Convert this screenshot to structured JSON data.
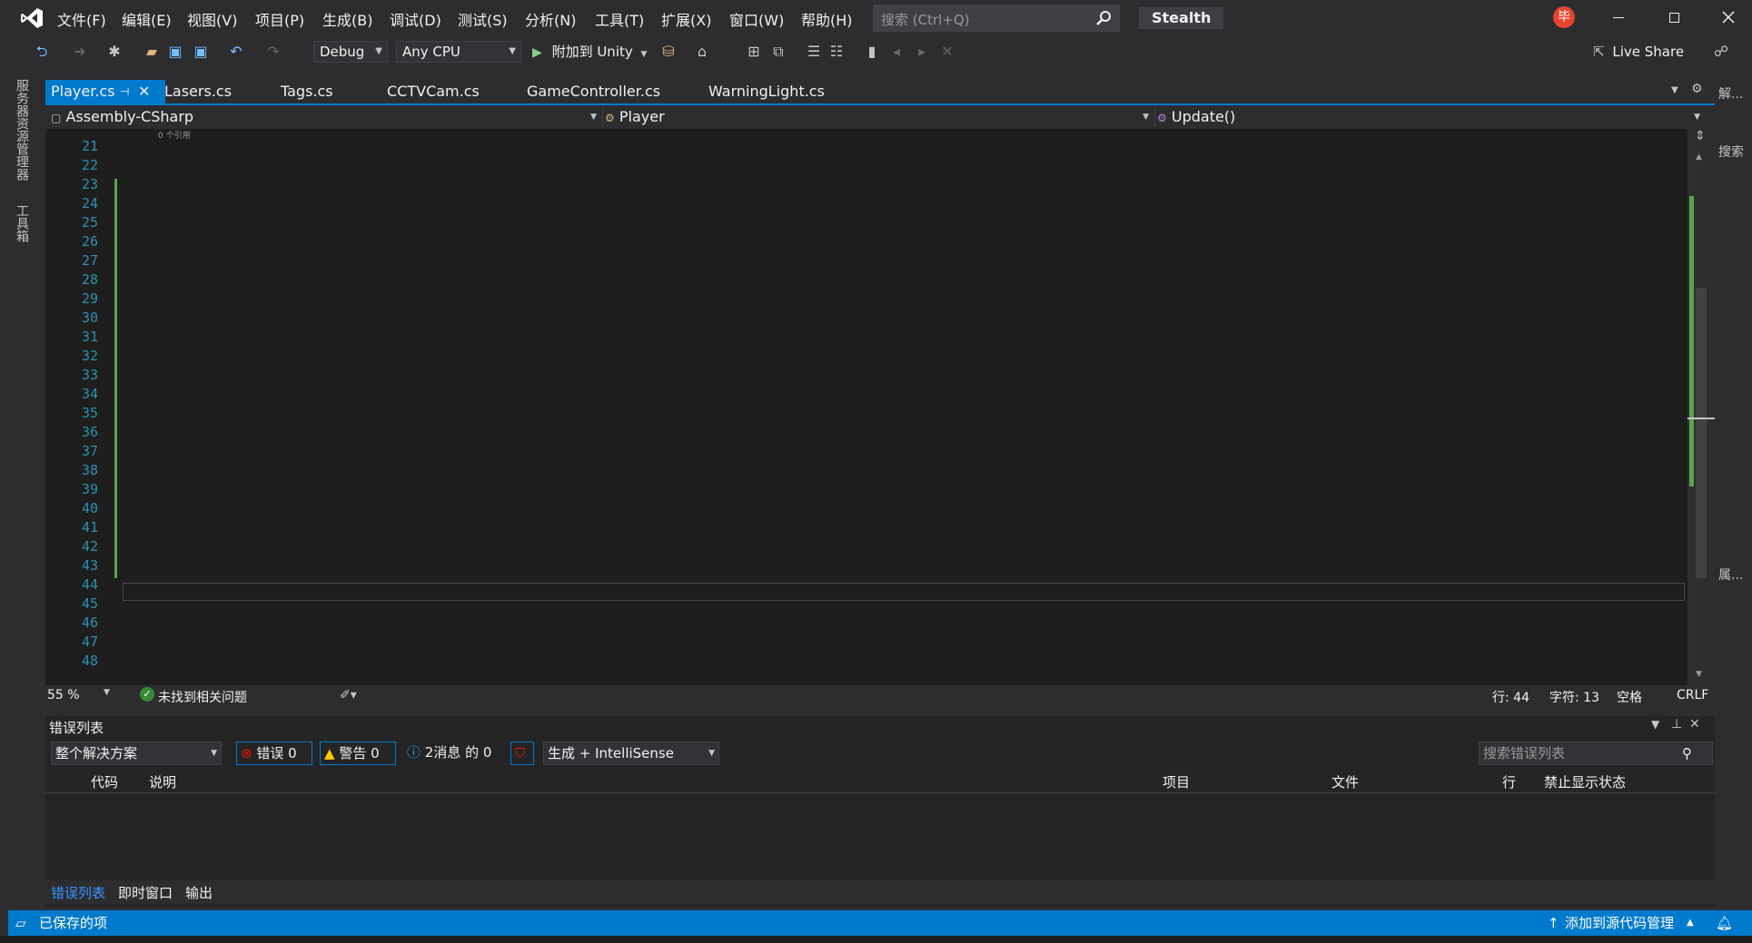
{
  "menu": [
    "文件(F)",
    "编辑(E)",
    "视图(V)",
    "项目(P)",
    "生成(B)",
    "调试(D)",
    "测试(S)",
    "分析(N)",
    "工具(T)",
    "扩展(X)",
    "窗口(W)",
    "帮助(H)"
  ],
  "search": {
    "placeholder": "搜索 (Ctrl+Q)"
  },
  "solution_name": "Stealth",
  "user_badge": "毕",
  "toolbar": {
    "config": "Debug",
    "platform": "Any CPU",
    "run_label": "附加到 Unity",
    "live_share": "Live Share"
  },
  "left_strip": [
    "服务器资源管理器",
    "工具箱"
  ],
  "tabs": [
    "Player.cs",
    "Lasers.cs",
    "Tags.cs",
    "CCTVCam.cs",
    "GameController.cs",
    "WarningLight.cs"
  ],
  "tab_pin": "⊣",
  "navbar": {
    "project": "Assembly-CSharp",
    "class": "Player",
    "member": "Update()"
  },
  "codelens": "0 个引用",
  "line_numbers": [
    "21",
    "22",
    "23",
    "24",
    "25",
    "26",
    "27",
    "28",
    "29",
    "30",
    "31",
    "32",
    "33",
    "34",
    "35",
    "36",
    "37",
    "38",
    "39",
    "40",
    "41",
    "42",
    "43",
    "44",
    "45",
    "46",
    "47",
    "48"
  ],
  "editor_status": {
    "zoom": "55 %",
    "issues": "未找到相关问题",
    "line": "行: 44",
    "col": "字符: 13",
    "spaces": "空格",
    "eol": "CRLF"
  },
  "errlist": {
    "title": "错误列表",
    "scope": "整个解决方案",
    "errors": "错误 0",
    "warnings": "警告 0",
    "messages": "2消息 的 0",
    "build_filter": "生成 + IntelliSense",
    "search_placeholder": "搜索错误列表",
    "columns": {
      "code": "代码",
      "desc": "说明",
      "project": "项目",
      "file": "文件",
      "line": "行",
      "suppress": "禁止显示状态"
    }
  },
  "bottom_tabs": [
    "错误列表",
    "即时窗口",
    "输出"
  ],
  "right_strip": [
    "解...",
    "搜索",
    "属..."
  ],
  "statusbar": {
    "left": "已保存的项",
    "right": "添加到源代码管理"
  }
}
